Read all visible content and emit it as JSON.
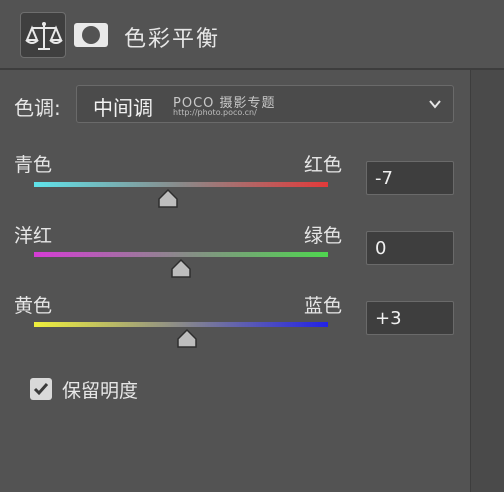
{
  "header": {
    "title": "色彩平衡"
  },
  "tone": {
    "label": "色调:",
    "value": "中间调"
  },
  "watermark": {
    "brand": "POCO 摄影专题",
    "url": "http://photo.poco.cn/"
  },
  "sliders": [
    {
      "left_label": "青色",
      "right_label": "红色",
      "value": "-7",
      "level": -7
    },
    {
      "left_label": "洋红",
      "right_label": "绿色",
      "value": "0",
      "level": 0
    },
    {
      "left_label": "黄色",
      "right_label": "蓝色",
      "value": "+3",
      "level": 3
    }
  ],
  "preserve": {
    "label": "保留明度",
    "checked": true
  },
  "colors": {
    "panel_bg": "#535353",
    "text": "#e6e6e6",
    "field_bg": "#3e3e3e"
  },
  "icons": {
    "balance": "balance-scale-icon",
    "mask": "layer-mask-icon",
    "dropdown": "chevron-down-icon",
    "check": "checkmark-icon"
  }
}
